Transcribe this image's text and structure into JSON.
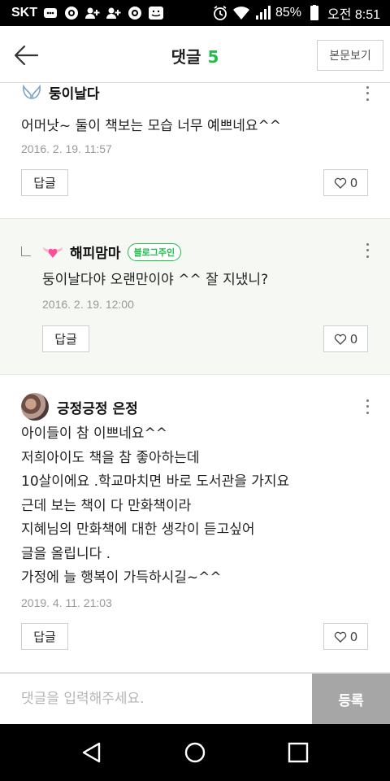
{
  "status_bar": {
    "carrier": "SKT",
    "battery": "85%",
    "time": "오전 8:51",
    "icons": [
      "messenger-icon",
      "cheese-icon",
      "person-add-icon",
      "person-add-icon",
      "cheese-icon",
      "app-icon",
      "alarm-icon",
      "wifi-icon",
      "signal-icon",
      "battery-icon"
    ]
  },
  "header": {
    "title": "댓글",
    "count": "5",
    "view_post": "본문보기"
  },
  "comments": [
    {
      "author": "둥이날다",
      "icon": "angel-wings-icon",
      "body": "어머낫~ 둘이 책보는 모습 너무 예쁘네요^^",
      "date": "2016. 2. 19. 11:57",
      "reply_label": "답글",
      "likes": "0"
    },
    {
      "author": "해피맘마",
      "icon": "heart-wings-icon",
      "badge": "블로그주인",
      "body": "둥이날다야 오랜만이야 ^^ 잘 지냈니?",
      "date": "2016. 2. 19. 12:00",
      "reply_label": "답글",
      "likes": "0"
    },
    {
      "author": "긍정긍정 은정",
      "icon": "avatar",
      "body": "아이들이 참 이쁘네요^^\n저희아이도 책을 참 좋아하는데\n10살이에요 .학교마치면 바로 도서관을 가지요\n근데 보는 책이 다 만화책이라\n지혜님의 만화책에 대한 생각이 듣고싶어\n글을 올립니다 .\n가정에 늘 행복이 가득하시길~^^",
      "date": "2019. 4. 11. 21:03",
      "reply_label": "답글",
      "likes": "0"
    }
  ],
  "input": {
    "placeholder": "댓글을 입력해주세요.",
    "submit": "등록"
  },
  "colors": {
    "accent": "#1fbe4a",
    "reply_bg": "#f6f8f3",
    "submit_bg": "#a6a6a6"
  }
}
